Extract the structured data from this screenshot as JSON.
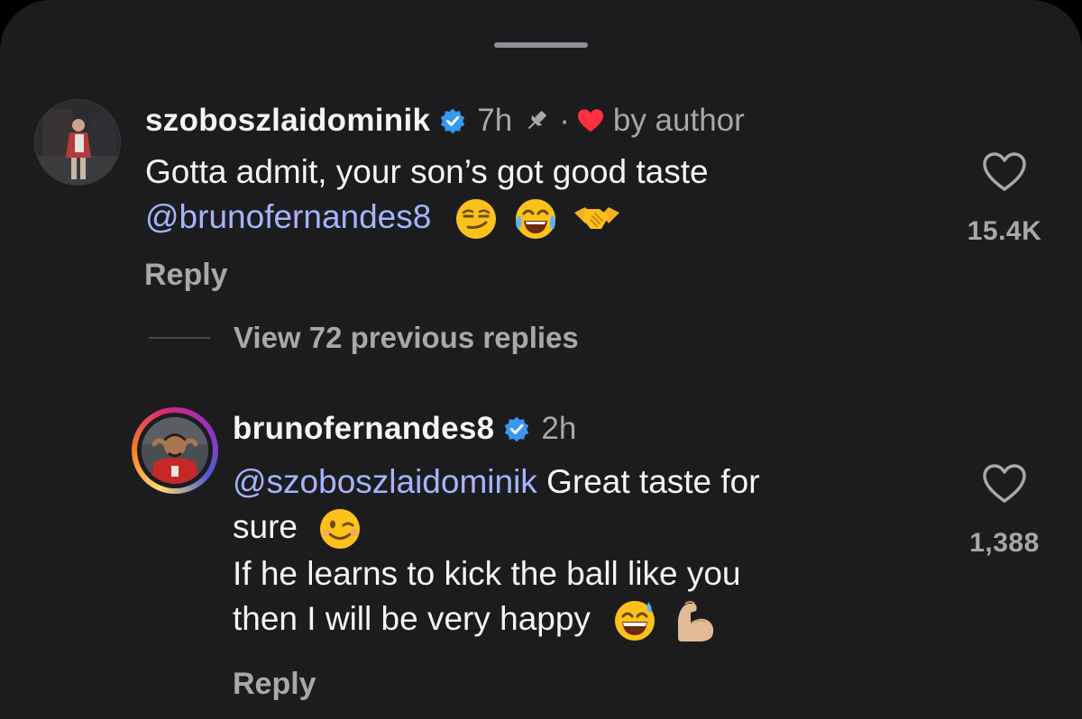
{
  "comments": [
    {
      "username": "szoboszlaidominik",
      "time": "7h",
      "separator": "·",
      "liked_by": "by author",
      "text": "Gotta admit, your son’s got good taste",
      "mention": "@brunofernandes8",
      "emojis": [
        "smirking-face",
        "face-with-tears-of-joy",
        "handshake"
      ],
      "reply_label": "Reply",
      "likes": "15.4K"
    },
    {
      "username": "brunofernandes8",
      "time": "2h",
      "mention": "@szoboszlaidominik",
      "text_line1": "Great taste for",
      "text_line2": "sure",
      "text_line3": "If he learns to kick the ball like you",
      "text_line4": "then I will be very happy",
      "emojis": [
        "winking-face",
        "grinning-face-with-sweat",
        "flexed-biceps"
      ],
      "reply_label": "Reply",
      "likes": "1,388"
    }
  ],
  "view_replies": "View 72 previous replies",
  "colors": {
    "background": "#1c1c1e",
    "mention": "#a5b4ff",
    "muted": "#a8a8a8",
    "verified": "#3897f0",
    "heart": "#ff3040"
  }
}
